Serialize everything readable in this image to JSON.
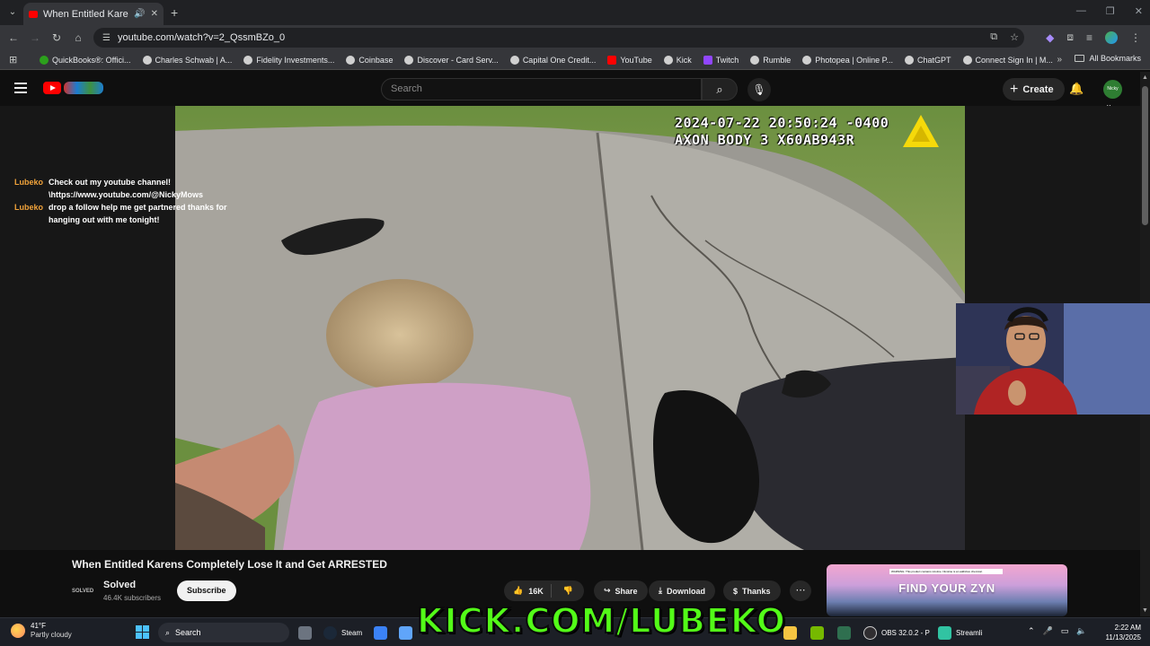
{
  "browser": {
    "tab_title": "When Entitled Karens Comp",
    "url": "youtube.com/watch?v=2_QssmBZo_0",
    "bookmarks": [
      "QuickBooks®: Offici...",
      "Charles Schwab | A...",
      "Fidelity Investments...",
      "Coinbase",
      "Discover - Card Serv...",
      "Capital One Credit...",
      "YouTube",
      "Kick",
      "Twitch",
      "Rumble",
      "Photopea | Online P...",
      "ChatGPT",
      "Connect Sign In | M..."
    ],
    "all_bookmarks": "All Bookmarks"
  },
  "youtube": {
    "search_placeholder": "Search",
    "create_label": "Create",
    "avatar_text": "Nicky Mows"
  },
  "chat": [
    {
      "user": "Lubeko",
      "text": "Check out my youtube channel! \\https://www.youtube.com/@NickyMows"
    },
    {
      "user": "Lubeko",
      "text": "drop a follow help me get partnered thanks for hanging out with me tonight!"
    }
  ],
  "video": {
    "timestamp": "2024-07-22 20:50:24 -0400",
    "device": "AXON BODY 3 X60AB943R",
    "title": "When Entitled Karens Completely Lose It and Get ARRESTED",
    "channel": "Solved",
    "channel_logo_text": "SOLVED",
    "subscribers": "46.4K subscribers",
    "subscribe_label": "Subscribe",
    "likes": "16K",
    "share_label": "Share",
    "download_label": "Download",
    "thanks_label": "Thanks"
  },
  "ad": {
    "warning": "WARNING: This product contains nicotine. Nicotine is an addictive chemical.",
    "headline": "FIND YOUR ZYN"
  },
  "overlay": {
    "kick_text": "KICK.COM/LUBEKO"
  },
  "taskbar": {
    "temperature": "41°F",
    "condition": "Partly cloudy",
    "search_label": "Search",
    "apps": [
      "Steam",
      "OBS 32.0.2 - P",
      "Streamli"
    ],
    "time": "2:22 AM",
    "date": "11/13/2025"
  },
  "colors": {
    "youtube_red": "#ff0000",
    "kick_green": "#53fc18",
    "chat_user": "#f0a23a"
  }
}
